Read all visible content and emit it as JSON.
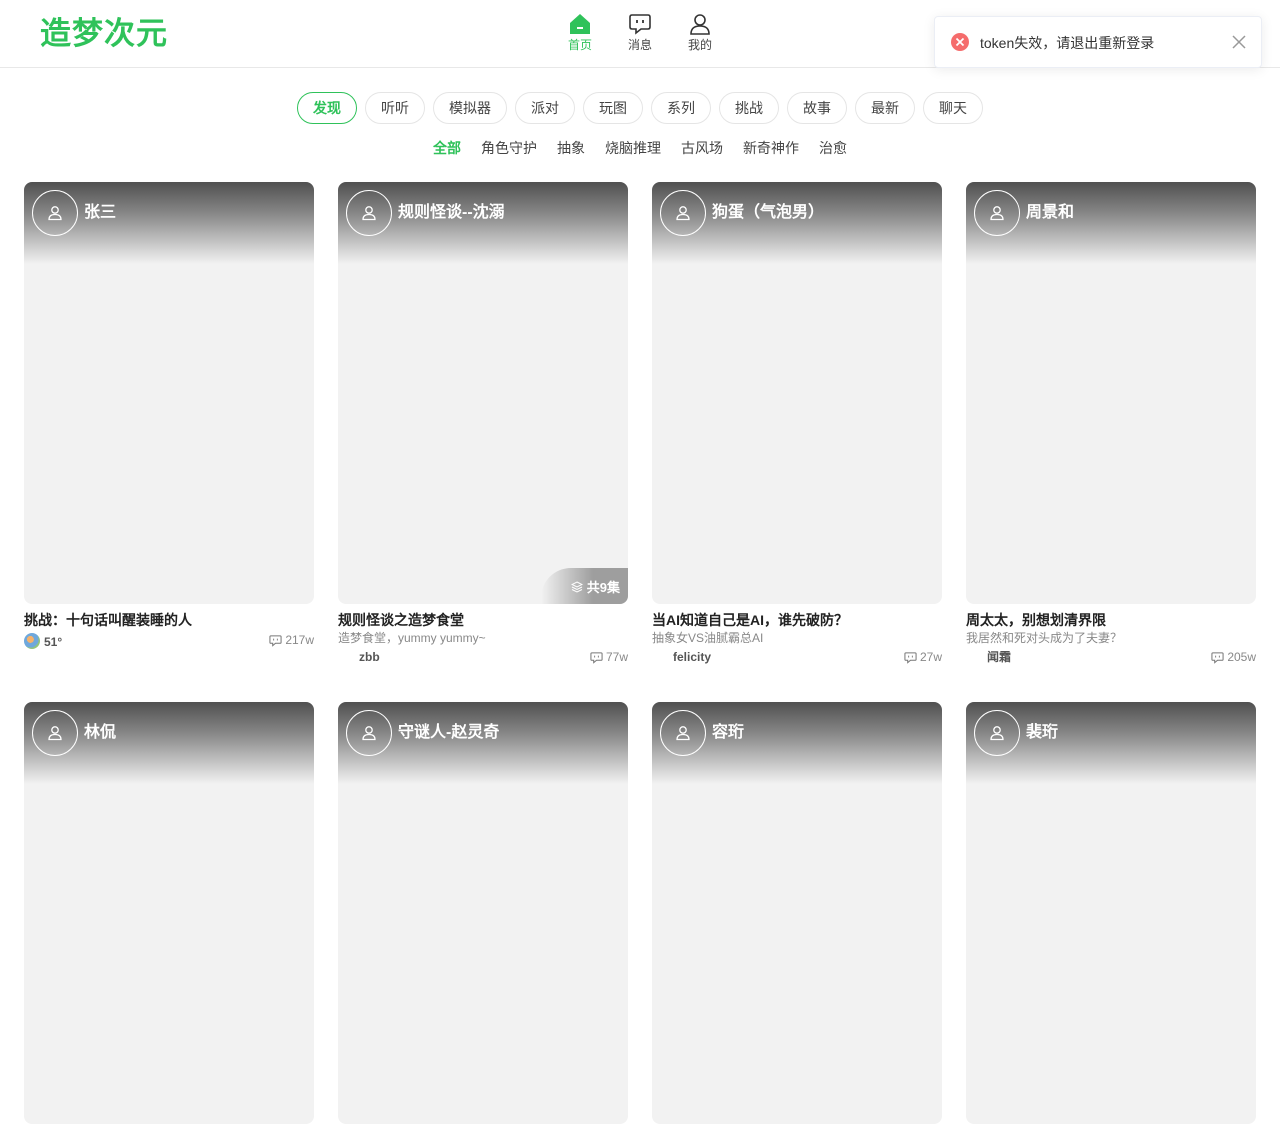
{
  "app": {
    "logo": "造梦次元",
    "accent_color": "#2fc25a"
  },
  "nav": [
    {
      "label": "首页",
      "icon": "home-icon",
      "active": true
    },
    {
      "label": "消息",
      "icon": "message-icon",
      "active": false
    },
    {
      "label": "我的",
      "icon": "user-icon",
      "active": false
    }
  ],
  "toast": {
    "text": "token失效，请退出重新登录",
    "icon": "error-circle-icon",
    "close_icon": "close-icon"
  },
  "tabs": [
    "发现",
    "听听",
    "模拟器",
    "派对",
    "玩图",
    "系列",
    "挑战",
    "故事",
    "最新",
    "聊天"
  ],
  "active_tab": "发现",
  "subtabs": [
    "全部",
    "角色守护",
    "抽象",
    "烧脑推理",
    "古风场",
    "新奇神作",
    "治愈"
  ],
  "active_subtab": "全部",
  "cards": [
    {
      "character": "张三",
      "title": "挑战：十句话叫醒装睡的人",
      "subtitle": "",
      "author": "51°",
      "comments": "217w",
      "episodes": ""
    },
    {
      "character": "规则怪谈--沈溺",
      "title": "规则怪谈之造梦食堂",
      "subtitle": "造梦食堂，yummy yummy~",
      "author": "zbb",
      "comments": "77w",
      "episodes": "共9集"
    },
    {
      "character": "狗蛋（气泡男）",
      "title": "当AI知道自己是AI，谁先破防？",
      "subtitle": "抽象女VS油腻霸总AI",
      "author": "felicity",
      "comments": "27w",
      "episodes": ""
    },
    {
      "character": "周景和",
      "title": "周太太，别想划清界限",
      "subtitle": "我居然和死对头成为了夫妻？",
      "author": "闻霜",
      "comments": "205w",
      "episodes": ""
    },
    {
      "character": "林侃",
      "title": "",
      "subtitle": "",
      "author": "",
      "comments": "",
      "episodes": ""
    },
    {
      "character": "守谜人-赵灵奇",
      "title": "",
      "subtitle": "",
      "author": "",
      "comments": "",
      "episodes": ""
    },
    {
      "character": "容珩",
      "title": "",
      "subtitle": "",
      "author": "",
      "comments": "",
      "episodes": ""
    },
    {
      "character": "裴珩",
      "title": "",
      "subtitle": "",
      "author": "",
      "comments": "",
      "episodes": ""
    }
  ]
}
